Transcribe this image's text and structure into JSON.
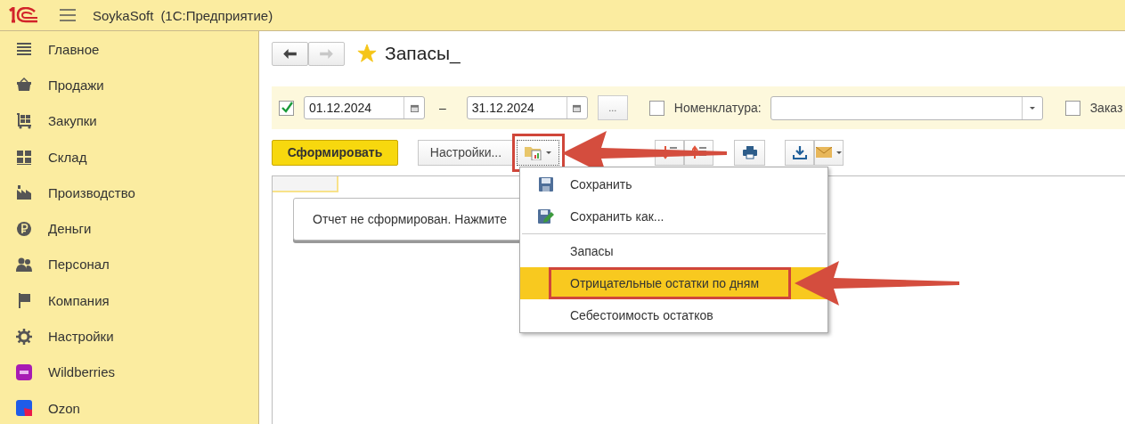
{
  "header": {
    "app_name": "SoykaSoft",
    "mode": "(1С:Предприятие)"
  },
  "sidebar": {
    "items": [
      {
        "label": "Главное"
      },
      {
        "label": "Продажи"
      },
      {
        "label": "Закупки"
      },
      {
        "label": "Склад"
      },
      {
        "label": "Производство"
      },
      {
        "label": "Деньги"
      },
      {
        "label": "Персонал"
      },
      {
        "label": "Компания"
      },
      {
        "label": "Настройки"
      },
      {
        "label": "Wildberries"
      },
      {
        "label": "Ozon"
      }
    ]
  },
  "form": {
    "title": "Запасы_",
    "favorite": true,
    "back_enabled": true,
    "forward_enabled": false
  },
  "filters": {
    "period": {
      "checked": true
    },
    "date_from": "01.12.2024",
    "date_to": "31.12.2024",
    "dash": "–",
    "more_button": "...",
    "nomenclature": {
      "checked": false,
      "label": "Номенклатура:"
    },
    "order": {
      "checked": false,
      "label": "Заказ"
    }
  },
  "toolbar": {
    "generate": "Сформировать",
    "settings": "Настройки...",
    "variants_marked": true
  },
  "report": {
    "message": "Отчет не сформирован. Нажмите"
  },
  "menu": {
    "items": [
      {
        "kind": "save",
        "label": "Сохранить",
        "selected": false,
        "marked": false
      },
      {
        "kind": "save_as",
        "label": "Сохранить как...",
        "selected": false,
        "marked": false
      },
      {
        "kind": "variant",
        "label": "Запасы",
        "selected": false,
        "marked": false
      },
      {
        "kind": "variant",
        "label": "Отрицательные остатки по дням",
        "selected": true,
        "marked": true
      },
      {
        "kind": "variant",
        "label": "Себестоимость остатков",
        "selected": false,
        "marked": false
      }
    ]
  }
}
